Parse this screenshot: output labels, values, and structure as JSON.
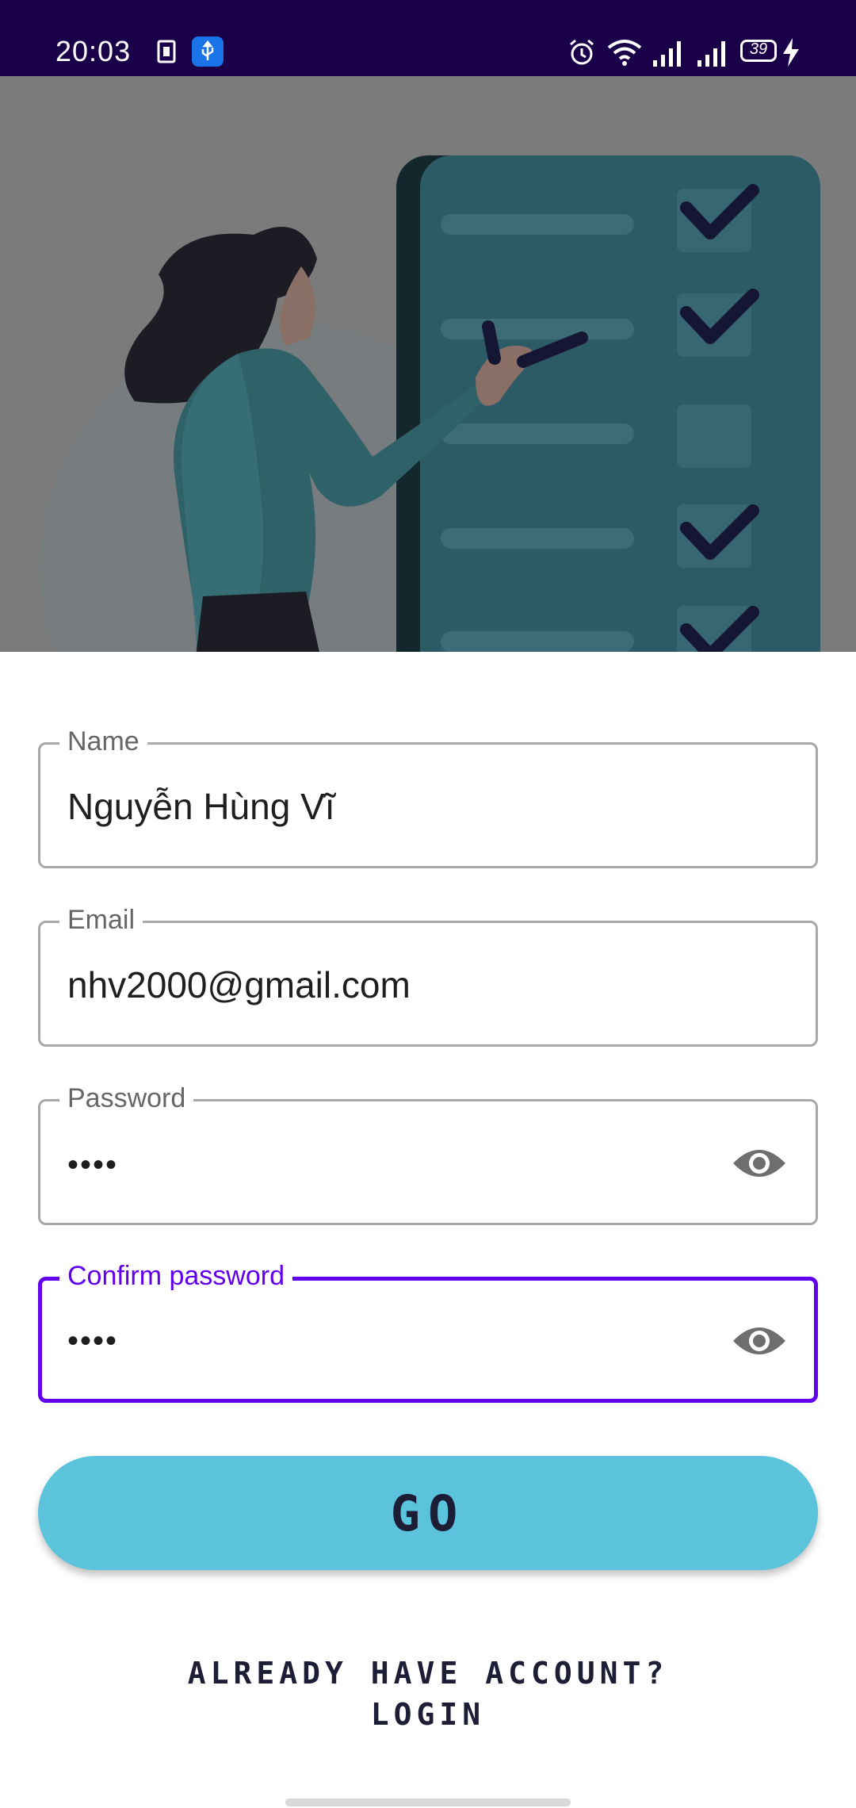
{
  "status_bar": {
    "time": "20:03",
    "battery": "39",
    "icons": [
      "sim-card-icon",
      "usb-icon",
      "alarm-icon",
      "wifi-icon",
      "signal-icon",
      "signal-icon",
      "battery-icon",
      "charging-icon"
    ]
  },
  "form": {
    "name": {
      "label": "Name",
      "value": "Nguyễn Hùng Vĩ"
    },
    "email": {
      "label": "Email",
      "value": "nhv2000@gmail.com"
    },
    "password": {
      "label": "Password",
      "value": "••••",
      "icon": "eye-icon"
    },
    "confirm_password": {
      "label": "Confirm password",
      "value": "••••",
      "icon": "eye-icon"
    }
  },
  "go_button": {
    "label": "GO"
  },
  "login_link": {
    "line1": "ALREADY HAVE ACCOUNT?",
    "line2": "LOGIN"
  },
  "colors": {
    "status_bar": "#1a0048",
    "accent": "#6200ee",
    "button": "#5bc3db",
    "button_text": "#1d1d36"
  }
}
